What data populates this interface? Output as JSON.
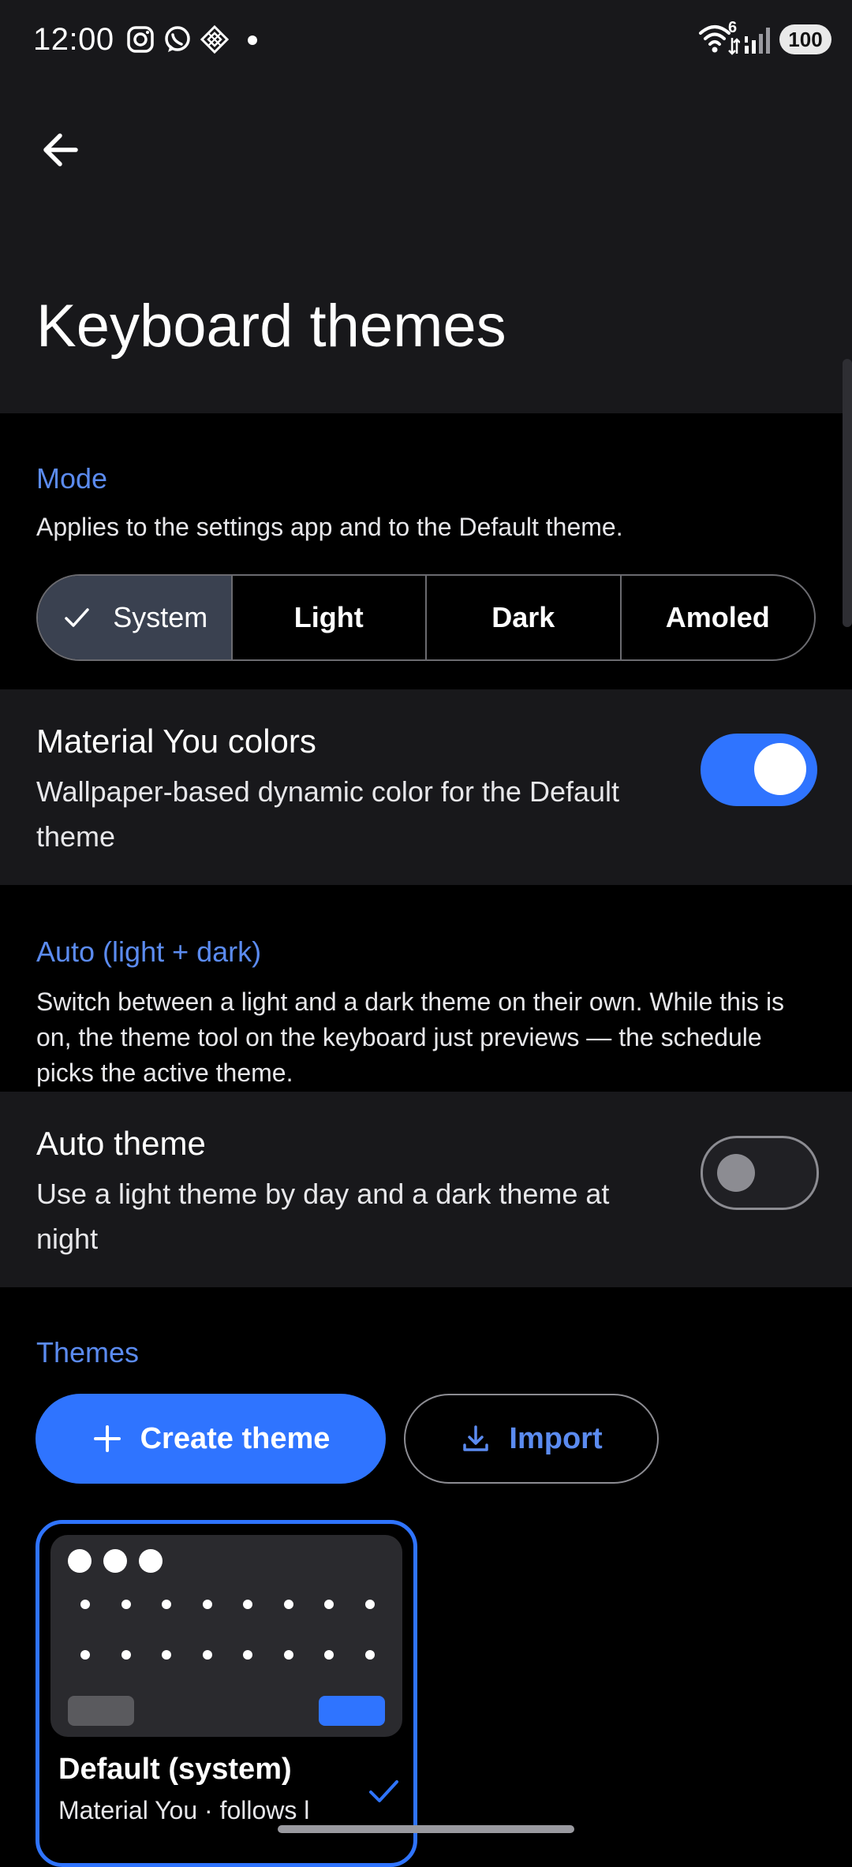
{
  "status_bar": {
    "time": "12:00",
    "notification_icons": [
      "instagram-icon",
      "whatsapp-icon",
      "app-diamond-icon",
      "dot-icon"
    ],
    "system_icons": [
      "wifi-icon",
      "signal-icon"
    ],
    "wifi_badge": "6",
    "battery": "100"
  },
  "header": {
    "back_icon": "arrow-left-icon",
    "title": "Keyboard themes"
  },
  "mode": {
    "label": "Mode",
    "description": "Applies to the settings app and to the Default theme.",
    "options": [
      "System",
      "Light",
      "Dark",
      "Amoled"
    ],
    "selected": "System"
  },
  "material_you": {
    "title": "Material You colors",
    "subtitle": "Wallpaper-based dynamic color for the Default theme",
    "enabled": true
  },
  "auto": {
    "label": "Auto (light + dark)",
    "description": "Switch between a light and a dark theme on their own. While this is on, the theme tool on the keyboard just previews — the schedule picks the active theme."
  },
  "auto_theme": {
    "title": "Auto theme",
    "subtitle": "Use a light theme by day and a dark theme at night",
    "enabled": false
  },
  "themes": {
    "label": "Themes",
    "create_label": "Create theme",
    "import_label": "Import",
    "items": [
      {
        "name": "Default (system)",
        "subtitle": "Material You · follows l",
        "selected": true
      }
    ]
  },
  "colors": {
    "accent": "#2f74ff",
    "section_label": "#5b8bf0",
    "surface": "#18181b",
    "background": "#000000"
  }
}
